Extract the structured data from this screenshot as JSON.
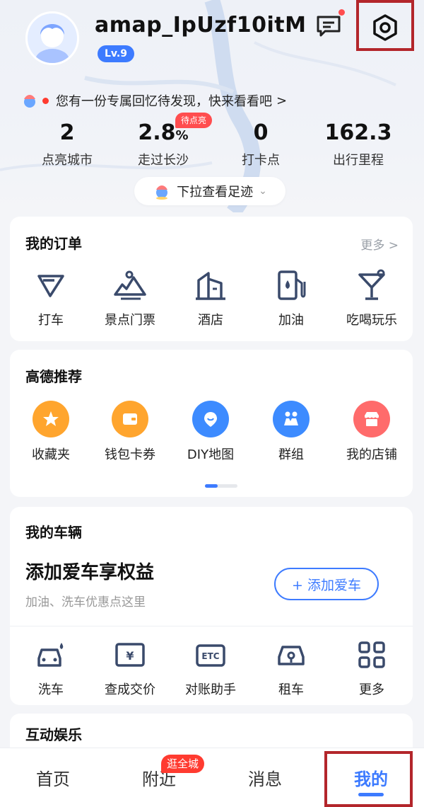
{
  "header": {
    "username": "amap_IpUzf10itM",
    "level": "Lv.9",
    "memory_banner": "您有一份专属回忆待发现，快来看看吧",
    "memory_chevron": ">",
    "pull_label": "下拉查看足迹",
    "pull_chevron": "⌄"
  },
  "stats": [
    {
      "value": "2",
      "unit": "",
      "label": "点亮城市"
    },
    {
      "value": "2.8",
      "unit": "%",
      "label": "走过长沙"
    },
    {
      "value": "0",
      "unit": "",
      "label": "打卡点"
    },
    {
      "value": "162.3",
      "unit": "",
      "label": "出行里程"
    }
  ],
  "pending_tag": "待点亮",
  "orders": {
    "title": "我的订单",
    "more": "更多 >",
    "items": [
      {
        "label": "打车",
        "icon": "taxi-icon"
      },
      {
        "label": "景点门票",
        "icon": "scenic-ticket-icon"
      },
      {
        "label": "酒店",
        "icon": "hotel-icon"
      },
      {
        "label": "加油",
        "icon": "fuel-icon"
      },
      {
        "label": "吃喝玩乐",
        "icon": "cocktail-icon"
      }
    ]
  },
  "recommend": {
    "title": "高德推荐",
    "items": [
      {
        "label": "收藏夹",
        "icon": "star-icon",
        "color": "#ffa52e"
      },
      {
        "label": "钱包卡券",
        "icon": "wallet-icon",
        "color": "#ffa52e"
      },
      {
        "label": "DIY地图",
        "icon": "map-pin-icon",
        "color": "#3d8bff"
      },
      {
        "label": "群组",
        "icon": "group-icon",
        "color": "#3d8bff"
      },
      {
        "label": "我的店铺",
        "icon": "shop-icon",
        "color": "#ff6b6b"
      }
    ]
  },
  "vehicle": {
    "title": "我的车辆",
    "headline": "添加爱车享权益",
    "subtitle": "加油、洗车优惠点这里",
    "add_button": "+ 添加爱车",
    "items": [
      {
        "label": "洗车",
        "icon": "car-wash-icon"
      },
      {
        "label": "查成交价",
        "icon": "price-icon"
      },
      {
        "label": "对账助手",
        "icon": "etc-icon"
      },
      {
        "label": "租车",
        "icon": "rent-car-icon"
      },
      {
        "label": "更多",
        "icon": "more-grid-icon"
      }
    ]
  },
  "entertainment": {
    "title": "互动娱乐"
  },
  "tabbar": {
    "items": [
      "首页",
      "附近",
      "消息",
      "我的"
    ],
    "badge": "逛全城",
    "active": "我的"
  },
  "colors": {
    "accent": "#3d7bff",
    "highlight_frame": "#b3262b",
    "badge": "#ff3b30"
  }
}
